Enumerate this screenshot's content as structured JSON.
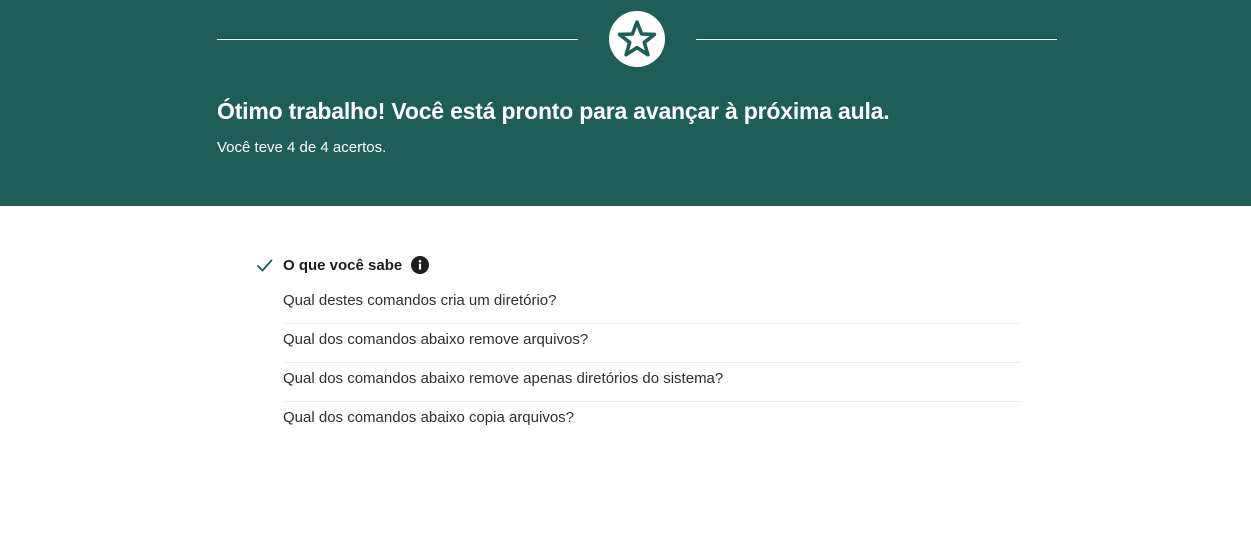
{
  "banner": {
    "icon": "star-icon",
    "headline": "Ótimo trabalho! Você está pronto para avançar à próxima aula.",
    "score_text": "Você teve 4 de 4 acertos.",
    "background_color": "#1f5e56"
  },
  "section": {
    "status_icon": "check-icon",
    "title": "O que você sabe",
    "info_icon": "info-icon",
    "questions": [
      "Qual destes comandos cria um diretório?",
      "Qual dos comandos abaixo remove arquivos?",
      "Qual dos comandos abaixo remove apenas diretórios do sistema?",
      "Qual dos comandos abaixo copia arquivos?"
    ]
  }
}
